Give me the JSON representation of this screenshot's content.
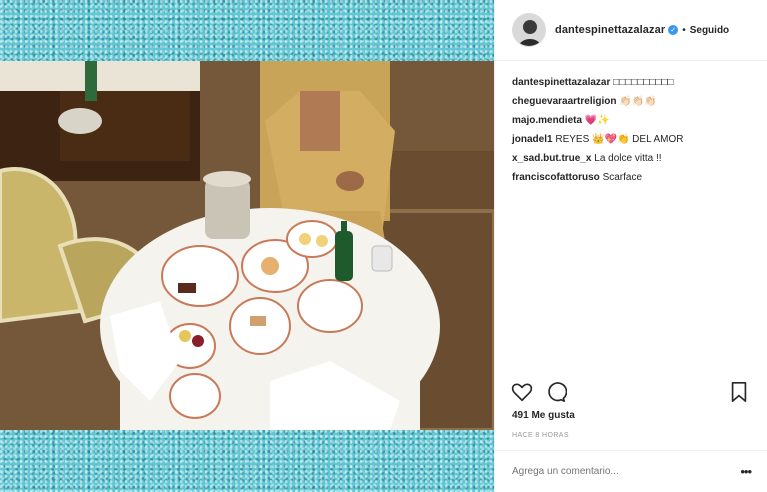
{
  "post": {
    "username": "dantespinettazalazar",
    "follow_status": "Seguido",
    "caption": "□□□□□□□□□□",
    "likes": "491 Me gusta",
    "timestamp": "HACE 8 HORAS",
    "comment_placeholder": "Agrega un comentario..."
  },
  "comments": [
    {
      "author": "cheguevaraartreligion",
      "text": "👏🏻👏🏻👏🏻"
    },
    {
      "author": "majo.mendieta",
      "text": "💗✨"
    },
    {
      "author": "jonadel1",
      "text": "REYES 👑💖👏 DEL AMOR"
    },
    {
      "author": "x_sad.but.true_x",
      "text": "La dolce vitta !!"
    },
    {
      "author": "franciscofattoruso",
      "text": "Scarface"
    }
  ],
  "icons": [
    "heart-icon",
    "comment-icon",
    "bookmark-icon",
    "more-options-icon",
    "verified-badge-icon"
  ],
  "colors": {
    "glitter": "#5fc6d3",
    "verified": "#3897f0",
    "muted": "#999999"
  }
}
